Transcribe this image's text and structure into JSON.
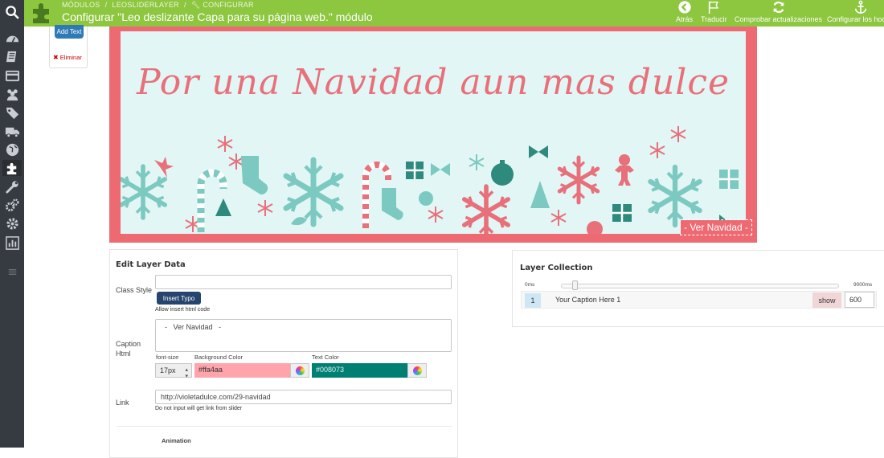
{
  "header": {
    "breadcrumb": [
      "Módulos",
      "LeoSliderLayer",
      "Configurar"
    ],
    "title": "Configurar \"Leo deslizante Capa para su página web.\" módulo",
    "toolbar": [
      {
        "label": "Atrás",
        "icon": "back-circle-icon"
      },
      {
        "label": "Traducir",
        "icon": "flag-icon"
      },
      {
        "label": "Comprobar actualizaciones",
        "icon": "refresh-icon"
      },
      {
        "label": "Configurar los hooks",
        "icon": "anchor-icon"
      }
    ]
  },
  "sidebar": {
    "items": [
      "search-icon",
      "dashboard-icon",
      "catalog-icon",
      "orders-icon",
      "customers-icon",
      "price-rules-icon",
      "shipping-icon",
      "localization-icon",
      "modules-icon",
      "preferences-icon",
      "advanced-parameters-icon",
      "administration-icon",
      "stats-icon",
      "collapse-menu-icon"
    ]
  },
  "layer_tools": {
    "add_text": "Add Text",
    "delete": "Eliminar"
  },
  "slider": {
    "title": "Por una Navidad aun mas dulce",
    "caption": "- Ver Navidad -"
  },
  "edit_layer": {
    "title": "Edit Layer Data",
    "class_style_label": "Class Style",
    "class_style_value": "",
    "insert_typo": "Insert Typo",
    "allow_html_hint": "Allow insert html code",
    "caption_label": "Caption Html",
    "caption_value": "  -   Ver Navidad   -",
    "font_size_label": "font-size",
    "font_size_value": "17px",
    "bg_color_label": "Background Color",
    "bg_color_value": "#ffa4aa",
    "text_color_label": "Text Color",
    "text_color_value": "#008073",
    "link_label": "Link",
    "link_value": "http://violetadulce.com/29-navidad",
    "link_hint": "Do not input will get link from slider",
    "animation_label": "Animation"
  },
  "layer_collection": {
    "title": "Layer Collection",
    "timeline_start": "0ms",
    "timeline_end": "9000ms",
    "rows": [
      {
        "num": "1",
        "caption": "Your Caption Here 1",
        "action": "show",
        "time": "600"
      }
    ]
  },
  "colors": {
    "header_green": "#8dc63f",
    "sidebar_dark": "#363a41",
    "slider_border": "#ee6a73",
    "slider_bg": "#e2f6f5",
    "bg_color": "#ffa4aa",
    "text_color": "#008073"
  }
}
